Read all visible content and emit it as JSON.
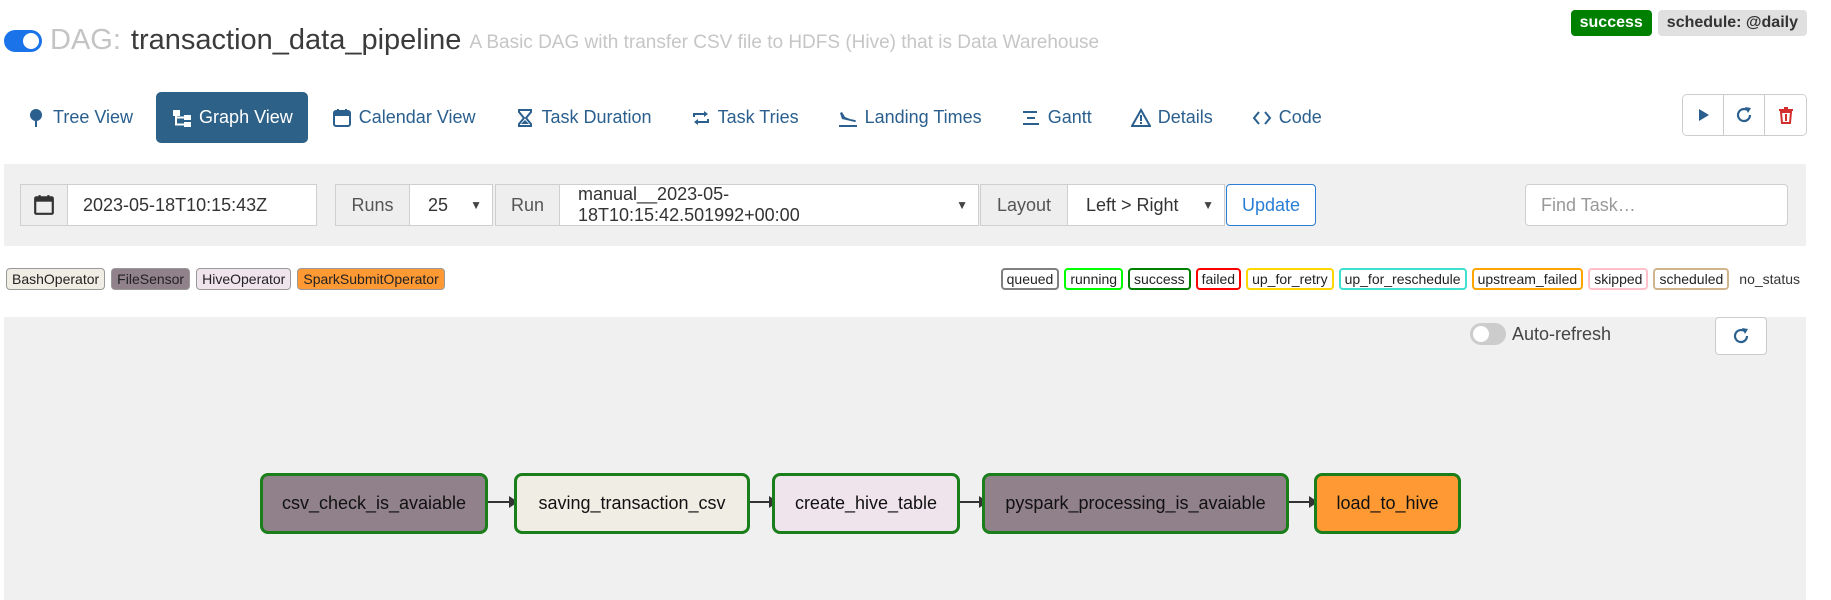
{
  "header": {
    "dag_prefix": "DAG:",
    "dag_id": "transaction_data_pipeline",
    "description": "A Basic DAG with transfer CSV file to HDFS (Hive) that is Data Warehouse",
    "status_badge": "success",
    "schedule_badge": "schedule: @daily"
  },
  "nav": {
    "tabs": [
      {
        "label": "Tree View",
        "icon": "tree-icon"
      },
      {
        "label": "Graph View",
        "icon": "graph-icon",
        "active": true
      },
      {
        "label": "Calendar View",
        "icon": "calendar-icon"
      },
      {
        "label": "Task Duration",
        "icon": "hourglass-icon"
      },
      {
        "label": "Task Tries",
        "icon": "retry-icon"
      },
      {
        "label": "Landing Times",
        "icon": "plane-landing-icon"
      },
      {
        "label": "Gantt",
        "icon": "gantt-icon"
      },
      {
        "label": "Details",
        "icon": "warning-triangle-icon"
      },
      {
        "label": "Code",
        "icon": "code-icon"
      }
    ]
  },
  "actions": [
    "play-icon",
    "refresh-icon",
    "trash-icon"
  ],
  "filter": {
    "date": "2023-05-18T10:15:43Z",
    "runs_label": "Runs",
    "runs_value": "25",
    "run_label": "Run",
    "run_value": "manual__2023-05-18T10:15:42.501992+00:00",
    "layout_label": "Layout",
    "layout_value": "Left > Right",
    "update_label": "Update",
    "find_placeholder": "Find Task…"
  },
  "operators_legend": [
    {
      "label": "BashOperator",
      "color": "#f0ede4"
    },
    {
      "label": "FileSensor",
      "color": "#91818a"
    },
    {
      "label": "HiveOperator",
      "color": "#f0e4ec"
    },
    {
      "label": "SparkSubmitOperator",
      "color": "#ff9933"
    }
  ],
  "status_legend": [
    {
      "label": "queued",
      "color": "#808080"
    },
    {
      "label": "running",
      "color": "#00ff00"
    },
    {
      "label": "success",
      "color": "#008000"
    },
    {
      "label": "failed",
      "color": "#ff0000"
    },
    {
      "label": "up_for_retry",
      "color": "#ffd700"
    },
    {
      "label": "up_for_reschedule",
      "color": "#40e0d0"
    },
    {
      "label": "upstream_failed",
      "color": "#ffa500"
    },
    {
      "label": "skipped",
      "color": "#ffc0cb"
    },
    {
      "label": "scheduled",
      "color": "#d2b48c"
    },
    {
      "label": "no_status",
      "color": ""
    }
  ],
  "graph": {
    "autorefresh_label": "Auto-refresh",
    "tasks": [
      {
        "id": "csv_check_is_avaiable",
        "color": "#91818a"
      },
      {
        "id": "saving_transaction_csv",
        "color": "#f0ede4"
      },
      {
        "id": "create_hive_table",
        "color": "#f0e4ec"
      },
      {
        "id": "pyspark_processing_is_avaiable",
        "color": "#91818a"
      },
      {
        "id": "load_to_hive",
        "color": "#ff9933"
      }
    ]
  }
}
